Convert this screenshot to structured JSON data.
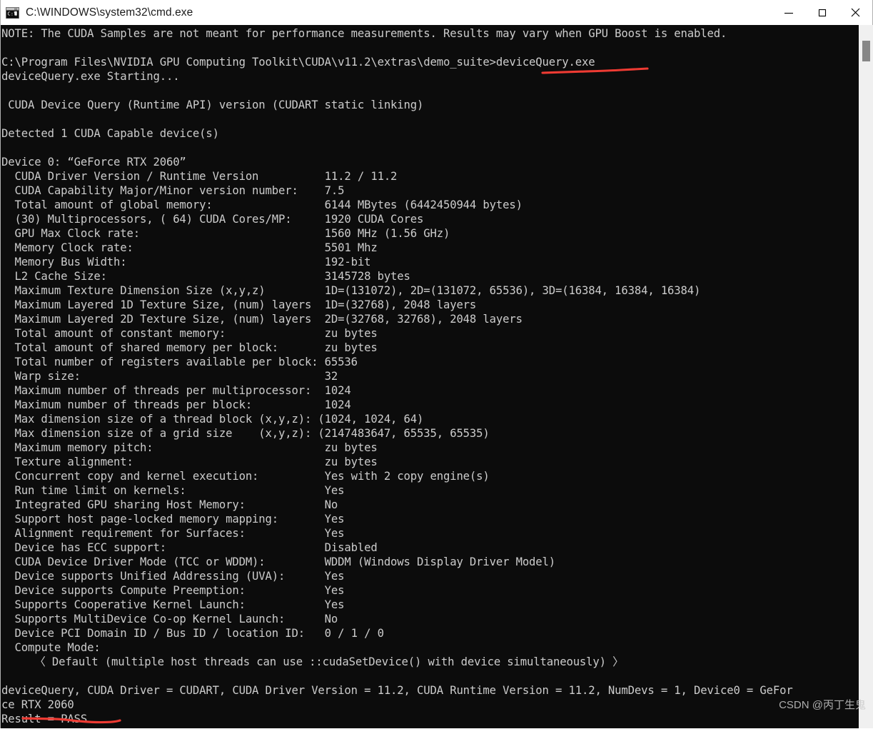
{
  "window": {
    "title": "C:\\WINDOWS\\system32\\cmd.exe",
    "icon": "cmd-console-icon",
    "controls": {
      "minimize": "minimize-button",
      "maximize": "maximize-button",
      "close": "close-button"
    }
  },
  "colors": {
    "console_background": "#0c0c0c",
    "console_text": "#cccccc",
    "titlebar_background": "#ffffff",
    "titlebar_text": "#1b1b1b",
    "annotation_red": "#ee3b33",
    "scrollbar_track": "#f0f0f0",
    "scrollbar_thumb": "#868686",
    "watermark_text": "#c9c9c9"
  },
  "console": {
    "lines": [
      "NOTE: The CUDA Samples are not meant for performance measurements. Results may vary when GPU Boost is enabled.",
      "",
      "C:\\Program Files\\NVIDIA GPU Computing Toolkit\\CUDA\\v11.2\\extras\\demo_suite>deviceQuery.exe",
      "deviceQuery.exe Starting...",
      "",
      " CUDA Device Query (Runtime API) version (CUDART static linking)",
      "",
      "Detected 1 CUDA Capable device(s)",
      "",
      "Device 0: “GeForce RTX 2060”",
      "  CUDA Driver Version / Runtime Version          11.2 / 11.2",
      "  CUDA Capability Major/Minor version number:    7.5",
      "  Total amount of global memory:                 6144 MBytes (6442450944 bytes)",
      "  (30) Multiprocessors, ( 64) CUDA Cores/MP:     1920 CUDA Cores",
      "  GPU Max Clock rate:                            1560 MHz (1.56 GHz)",
      "  Memory Clock rate:                             5501 Mhz",
      "  Memory Bus Width:                              192-bit",
      "  L2 Cache Size:                                 3145728 bytes",
      "  Maximum Texture Dimension Size (x,y,z)         1D=(131072), 2D=(131072, 65536), 3D=(16384, 16384, 16384)",
      "  Maximum Layered 1D Texture Size, (num) layers  1D=(32768), 2048 layers",
      "  Maximum Layered 2D Texture Size, (num) layers  2D=(32768, 32768), 2048 layers",
      "  Total amount of constant memory:               zu bytes",
      "  Total amount of shared memory per block:       zu bytes",
      "  Total number of registers available per block: 65536",
      "  Warp size:                                     32",
      "  Maximum number of threads per multiprocessor:  1024",
      "  Maximum number of threads per block:           1024",
      "  Max dimension size of a thread block (x,y,z): (1024, 1024, 64)",
      "  Max dimension size of a grid size    (x,y,z): (2147483647, 65535, 65535)",
      "  Maximum memory pitch:                          zu bytes",
      "  Texture alignment:                             zu bytes",
      "  Concurrent copy and kernel execution:          Yes with 2 copy engine(s)",
      "  Run time limit on kernels:                     Yes",
      "  Integrated GPU sharing Host Memory:            No",
      "  Support host page-locked memory mapping:       Yes",
      "  Alignment requirement for Surfaces:            Yes",
      "  Device has ECC support:                        Disabled",
      "  CUDA Device Driver Mode (TCC or WDDM):         WDDM (Windows Display Driver Model)",
      "  Device supports Unified Addressing (UVA):      Yes",
      "  Device supports Compute Preemption:            Yes",
      "  Supports Cooperative Kernel Launch:            Yes",
      "  Supports MultiDevice Co-op Kernel Launch:      No",
      "  Device PCI Domain ID / Bus ID / location ID:   0 / 1 / 0",
      "  Compute Mode:",
      "     〈 Default (multiple host threads can use ::cudaSetDevice() with device simultaneously) 〉",
      "",
      "deviceQuery, CUDA Driver = CUDART, CUDA Driver Version = 11.2, CUDA Runtime Version = 11.2, NumDevs = 1, Device0 = GeFor",
      "ce RTX 2060",
      "Result = PASS"
    ]
  },
  "annotations": [
    {
      "name": "underline-devicequery",
      "target_text": "deviceQuery.exe",
      "color": "#ee3b33"
    },
    {
      "name": "underline-result-pass",
      "target_text": "Result = PASS",
      "color": "#ee3b33"
    }
  ],
  "watermark": {
    "text": "CSDN @丙丁生鬼"
  },
  "scrollbar": {
    "orientation": "vertical",
    "thumb_position": "near-top"
  }
}
